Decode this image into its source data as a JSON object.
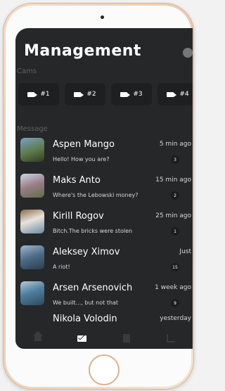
{
  "header": {
    "title": "Management"
  },
  "cams": {
    "label": "Cams",
    "items": [
      {
        "label": "#1"
      },
      {
        "label": "#2"
      },
      {
        "label": "#3"
      },
      {
        "label": "#4"
      }
    ]
  },
  "messages": {
    "label": "Message",
    "items": [
      {
        "name": "Aspen Mango",
        "time": "5 min ago",
        "preview": "Hello! How you are?",
        "badge": "3"
      },
      {
        "name": "Maks Anto",
        "time": "15 min ago",
        "preview": "Where's the Lebowski money?",
        "badge": "2"
      },
      {
        "name": "Kirill Rogov",
        "time": "25 min ago",
        "preview": "Bitch.The bricks were stolen",
        "badge": "1"
      },
      {
        "name": "Aleksey Ximov",
        "time": "Just",
        "preview": "A riot!",
        "badge": "15"
      },
      {
        "name": "Arsen Arsenovich",
        "time": "1 week ago",
        "preview": "We built..., but not that",
        "badge": "9"
      },
      {
        "name": "Nikola Volodin",
        "time": "yesterday",
        "preview": "",
        "badge": ""
      }
    ]
  },
  "tabs": [
    "home-icon",
    "mail-icon",
    "document-icon",
    "stats-icon"
  ]
}
